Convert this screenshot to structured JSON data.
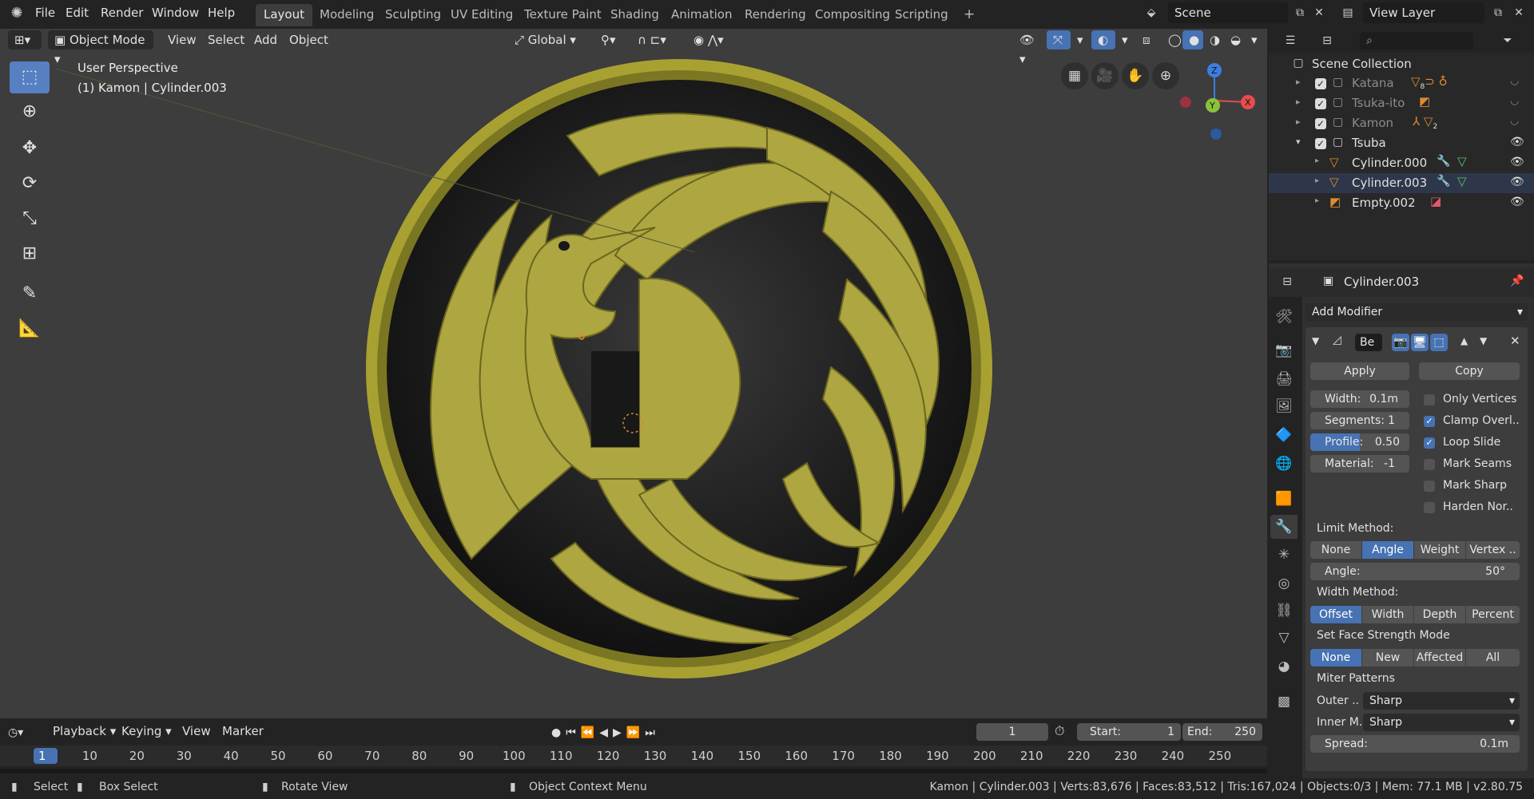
{
  "menu": {
    "file": "File",
    "edit": "Edit",
    "render": "Render",
    "window": "Window",
    "help": "Help"
  },
  "workspaces": [
    "Layout",
    "Modeling",
    "Sculpting",
    "UV Editing",
    "Texture Paint",
    "Shading",
    "Animation",
    "Rendering",
    "Compositing",
    "Scripting"
  ],
  "workspace_add": "+",
  "scene": {
    "name": "Scene",
    "view_layer": "View Layer"
  },
  "viewport_header": {
    "mode": "Object Mode",
    "view": "View",
    "select": "Select",
    "add": "Add",
    "object": "Object",
    "orientation": "Global"
  },
  "viewport_info": {
    "perspective": "User Perspective",
    "object": "(1) Kamon | Cylinder.003"
  },
  "gizmo": {
    "x": "X",
    "y": "Y",
    "z": "Z"
  },
  "timeline": {
    "playback": "Playback",
    "keying": "Keying",
    "view": "View",
    "marker": "Marker",
    "current_frame": "1",
    "start_label": "Start:",
    "start": "1",
    "end_label": "End:",
    "end": "250",
    "frames": [
      "1",
      "10",
      "20",
      "30",
      "40",
      "50",
      "60",
      "70",
      "80",
      "90",
      "100",
      "110",
      "120",
      "130",
      "140",
      "150",
      "160",
      "170",
      "180",
      "190",
      "200",
      "210",
      "220",
      "230",
      "240",
      "250"
    ]
  },
  "status": {
    "select": "Select",
    "box_select": "Box Select",
    "rotate": "Rotate View",
    "context": "Object Context Menu",
    "stats": "Kamon | Cylinder.003 | Verts:83,676 | Faces:83,512 | Tris:167,024 | Objects:0/3 | Mem: 77.1 MB | v2.80.75"
  },
  "outliner": {
    "root": "Scene Collection",
    "items": [
      {
        "label": "Katana",
        "badge": "8"
      },
      {
        "label": "Tsuka-ito",
        "badge": ""
      },
      {
        "label": "Kamon",
        "badge": "2"
      },
      {
        "label": "Tsuba",
        "badge": ""
      },
      {
        "label": "Cylinder.000",
        "badge": ""
      },
      {
        "label": "Cylinder.003",
        "badge": ""
      },
      {
        "label": "Empty.002",
        "badge": ""
      }
    ]
  },
  "properties": {
    "object_name": "Cylinder.003",
    "add_modifier": "Add Modifier",
    "modifier_name": "Be",
    "apply": "Apply",
    "copy": "Copy",
    "width_label": "Width:",
    "width": "0.1m",
    "segments_label": "Segments:",
    "segments": "1",
    "profile_label": "Profile:",
    "profile": "0.50",
    "material_label": "Material:",
    "material": "-1",
    "only_vertices": "Only Vertices",
    "clamp": "Clamp Overl..",
    "loop_slide": "Loop Slide",
    "mark_seams": "Mark Seams",
    "mark_sharp": "Mark Sharp",
    "harden": "Harden Nor..",
    "limit_method": "Limit Method:",
    "limit_opts": [
      "None",
      "Angle",
      "Weight",
      "Vertex .."
    ],
    "angle_label": "Angle:",
    "angle": "50°",
    "width_method": "Width Method:",
    "width_opts": [
      "Offset",
      "Width",
      "Depth",
      "Percent"
    ],
    "face_strength": "Set Face Strength Mode",
    "face_opts": [
      "None",
      "New",
      "Affected",
      "All"
    ],
    "miter": "Miter Patterns",
    "outer_label": "Outer ..",
    "outer": "Sharp",
    "inner_label": "Inner M..",
    "inner": "Sharp",
    "spread_label": "Spread:",
    "spread": "0.1m"
  },
  "colors": {
    "accent": "#4772b3",
    "gold": "#a8a132",
    "x_axis": "#e64c4c",
    "y_axis": "#8ac33a",
    "z_axis": "#3d7ee0"
  }
}
